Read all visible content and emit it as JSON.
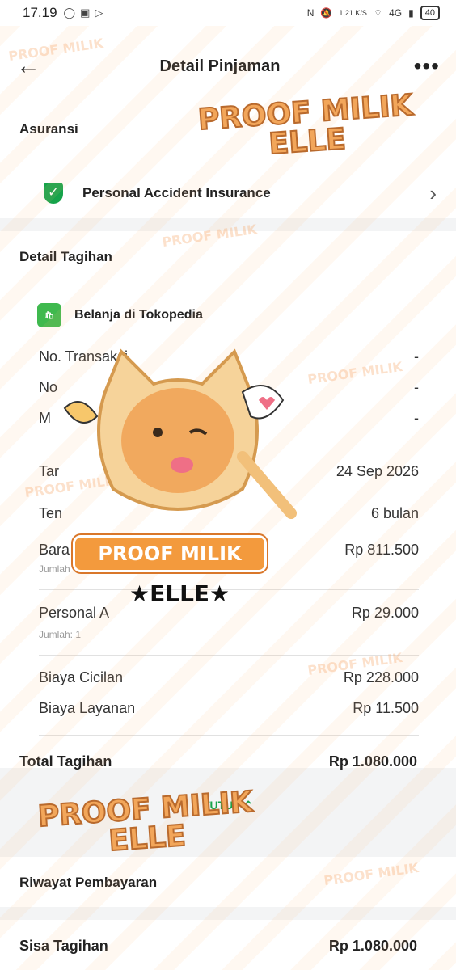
{
  "status_bar": {
    "time": "17.19",
    "net_speed": "1,21 K/S",
    "signal": "4G",
    "battery": "40"
  },
  "app_bar": {
    "title": "Detail Pinjaman",
    "back_icon": "arrow-left-icon",
    "more_icon": "more-dots-icon"
  },
  "asuransi": {
    "header": "Asuransi",
    "item": "Personal Accident Insurance"
  },
  "detail_tagihan": {
    "header": "Detail Tagihan",
    "merchant": "Belanja di Tokopedia",
    "rows": [
      {
        "label": "No. Transaksi",
        "value": "-"
      },
      {
        "label": "No",
        "value": "-"
      },
      {
        "label": "M",
        "value": "-"
      },
      {
        "label": "Tar",
        "value": "24 Sep 2026"
      },
      {
        "label": "Ten",
        "value": "6 bulan"
      }
    ],
    "items": [
      {
        "label": "Bara",
        "value": "Rp 811.500",
        "sub": "Jumlah"
      },
      {
        "label": "Personal A",
        "value": "Rp 29.000",
        "sub": "Jumlah: 1"
      }
    ],
    "fees": [
      {
        "label": "Biaya Cicilan",
        "value": "Rp 228.000"
      },
      {
        "label": "Biaya Layanan",
        "value": "Rp 11.500"
      }
    ],
    "total_label": "Total Tagihan",
    "total_value": "Rp 1.080.000",
    "collapse_label": "TUTUP"
  },
  "riwayat": {
    "header": "Riwayat Pembayaran"
  },
  "sisa": {
    "label": "Sisa Tagihan",
    "value": "Rp 1.080.000"
  },
  "watermark": {
    "text": "PROOF MILIK",
    "name": "ELLE"
  },
  "colors": {
    "accent_green": "#16a34a",
    "watermark_orange": "#f2a65a",
    "background": "#f3f4f5"
  }
}
